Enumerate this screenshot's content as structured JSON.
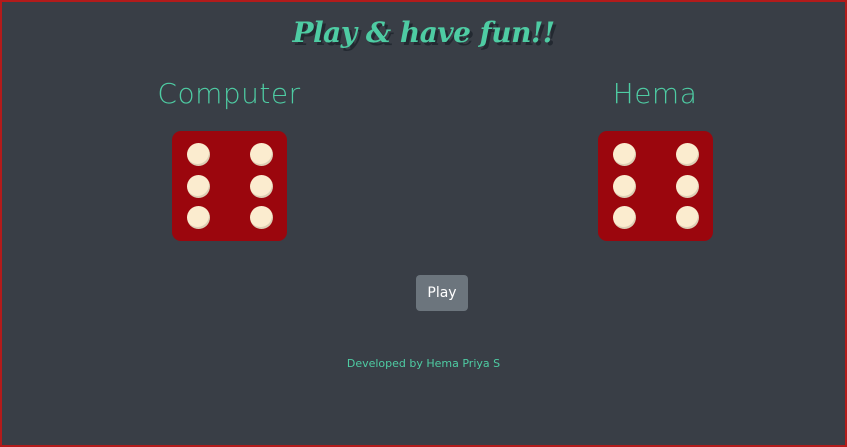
{
  "page": {
    "title": "Play & have fun!!",
    "footer": "Developed by Hema Priya S"
  },
  "players": [
    {
      "name": "Computer",
      "die_value": 6
    },
    {
      "name": "Hema",
      "die_value": 6
    }
  ],
  "controls": {
    "play_label": "Play"
  },
  "colors": {
    "background": "#393e46",
    "accent": "#4ecca3",
    "die_face": "#9b060d",
    "pip": "#fbeccf",
    "button": "#6c757d",
    "border": "#b31b1b"
  }
}
